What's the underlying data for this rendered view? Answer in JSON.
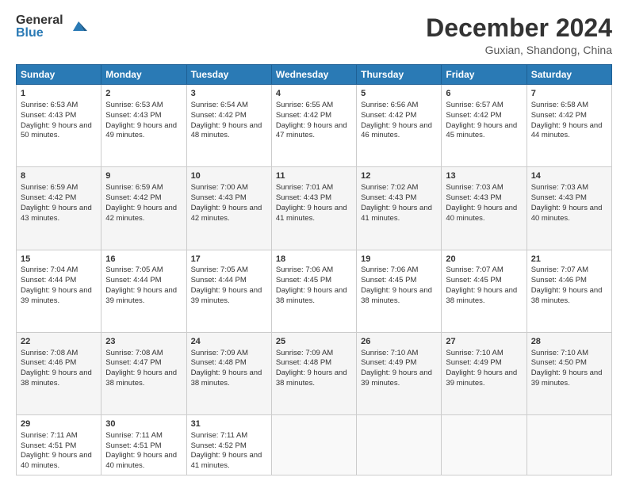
{
  "logo": {
    "general": "General",
    "blue": "Blue"
  },
  "title": "December 2024",
  "location": "Guxian, Shandong, China",
  "days": [
    "Sunday",
    "Monday",
    "Tuesday",
    "Wednesday",
    "Thursday",
    "Friday",
    "Saturday"
  ],
  "weeks": [
    [
      {
        "day": "1",
        "sunrise": "6:53 AM",
        "sunset": "4:43 PM",
        "daylight": "9 hours and 50 minutes."
      },
      {
        "day": "2",
        "sunrise": "6:53 AM",
        "sunset": "4:43 PM",
        "daylight": "9 hours and 49 minutes."
      },
      {
        "day": "3",
        "sunrise": "6:54 AM",
        "sunset": "4:42 PM",
        "daylight": "9 hours and 48 minutes."
      },
      {
        "day": "4",
        "sunrise": "6:55 AM",
        "sunset": "4:42 PM",
        "daylight": "9 hours and 47 minutes."
      },
      {
        "day": "5",
        "sunrise": "6:56 AM",
        "sunset": "4:42 PM",
        "daylight": "9 hours and 46 minutes."
      },
      {
        "day": "6",
        "sunrise": "6:57 AM",
        "sunset": "4:42 PM",
        "daylight": "9 hours and 45 minutes."
      },
      {
        "day": "7",
        "sunrise": "6:58 AM",
        "sunset": "4:42 PM",
        "daylight": "9 hours and 44 minutes."
      }
    ],
    [
      {
        "day": "8",
        "sunrise": "6:59 AM",
        "sunset": "4:42 PM",
        "daylight": "9 hours and 43 minutes."
      },
      {
        "day": "9",
        "sunrise": "6:59 AM",
        "sunset": "4:42 PM",
        "daylight": "9 hours and 42 minutes."
      },
      {
        "day": "10",
        "sunrise": "7:00 AM",
        "sunset": "4:43 PM",
        "daylight": "9 hours and 42 minutes."
      },
      {
        "day": "11",
        "sunrise": "7:01 AM",
        "sunset": "4:43 PM",
        "daylight": "9 hours and 41 minutes."
      },
      {
        "day": "12",
        "sunrise": "7:02 AM",
        "sunset": "4:43 PM",
        "daylight": "9 hours and 41 minutes."
      },
      {
        "day": "13",
        "sunrise": "7:03 AM",
        "sunset": "4:43 PM",
        "daylight": "9 hours and 40 minutes."
      },
      {
        "day": "14",
        "sunrise": "7:03 AM",
        "sunset": "4:43 PM",
        "daylight": "9 hours and 40 minutes."
      }
    ],
    [
      {
        "day": "15",
        "sunrise": "7:04 AM",
        "sunset": "4:44 PM",
        "daylight": "9 hours and 39 minutes."
      },
      {
        "day": "16",
        "sunrise": "7:05 AM",
        "sunset": "4:44 PM",
        "daylight": "9 hours and 39 minutes."
      },
      {
        "day": "17",
        "sunrise": "7:05 AM",
        "sunset": "4:44 PM",
        "daylight": "9 hours and 39 minutes."
      },
      {
        "day": "18",
        "sunrise": "7:06 AM",
        "sunset": "4:45 PM",
        "daylight": "9 hours and 38 minutes."
      },
      {
        "day": "19",
        "sunrise": "7:06 AM",
        "sunset": "4:45 PM",
        "daylight": "9 hours and 38 minutes."
      },
      {
        "day": "20",
        "sunrise": "7:07 AM",
        "sunset": "4:45 PM",
        "daylight": "9 hours and 38 minutes."
      },
      {
        "day": "21",
        "sunrise": "7:07 AM",
        "sunset": "4:46 PM",
        "daylight": "9 hours and 38 minutes."
      }
    ],
    [
      {
        "day": "22",
        "sunrise": "7:08 AM",
        "sunset": "4:46 PM",
        "daylight": "9 hours and 38 minutes."
      },
      {
        "day": "23",
        "sunrise": "7:08 AM",
        "sunset": "4:47 PM",
        "daylight": "9 hours and 38 minutes."
      },
      {
        "day": "24",
        "sunrise": "7:09 AM",
        "sunset": "4:48 PM",
        "daylight": "9 hours and 38 minutes."
      },
      {
        "day": "25",
        "sunrise": "7:09 AM",
        "sunset": "4:48 PM",
        "daylight": "9 hours and 38 minutes."
      },
      {
        "day": "26",
        "sunrise": "7:10 AM",
        "sunset": "4:49 PM",
        "daylight": "9 hours and 39 minutes."
      },
      {
        "day": "27",
        "sunrise": "7:10 AM",
        "sunset": "4:49 PM",
        "daylight": "9 hours and 39 minutes."
      },
      {
        "day": "28",
        "sunrise": "7:10 AM",
        "sunset": "4:50 PM",
        "daylight": "9 hours and 39 minutes."
      }
    ],
    [
      {
        "day": "29",
        "sunrise": "7:11 AM",
        "sunset": "4:51 PM",
        "daylight": "9 hours and 40 minutes."
      },
      {
        "day": "30",
        "sunrise": "7:11 AM",
        "sunset": "4:51 PM",
        "daylight": "9 hours and 40 minutes."
      },
      {
        "day": "31",
        "sunrise": "7:11 AM",
        "sunset": "4:52 PM",
        "daylight": "9 hours and 41 minutes."
      },
      null,
      null,
      null,
      null
    ]
  ],
  "labels": {
    "sunrise": "Sunrise:",
    "sunset": "Sunset:",
    "daylight": "Daylight:"
  }
}
